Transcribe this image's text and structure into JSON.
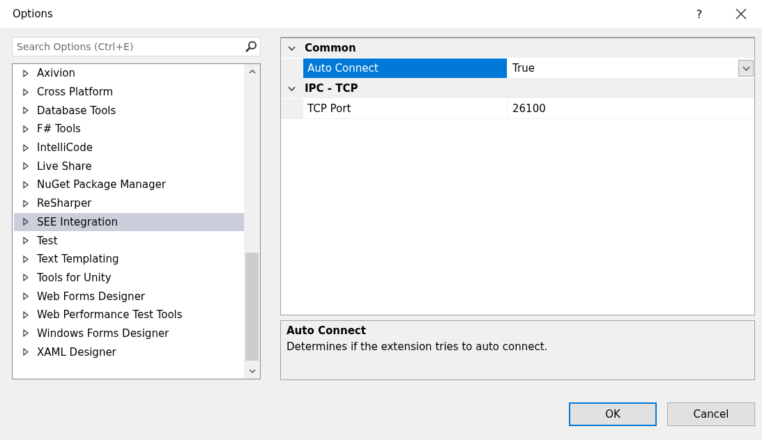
{
  "window": {
    "title": "Options",
    "help": "?"
  },
  "search": {
    "placeholder": "Search Options (Ctrl+E)"
  },
  "tree": {
    "items": [
      {
        "label": "Axivion",
        "selected": false,
        "expanded": false
      },
      {
        "label": "Cross Platform",
        "selected": false,
        "expanded": false
      },
      {
        "label": "Database Tools",
        "selected": false,
        "expanded": false
      },
      {
        "label": "F# Tools",
        "selected": false,
        "expanded": false
      },
      {
        "label": "IntelliCode",
        "selected": false,
        "expanded": false
      },
      {
        "label": "Live Share",
        "selected": false,
        "expanded": false
      },
      {
        "label": "NuGet Package Manager",
        "selected": false,
        "expanded": false
      },
      {
        "label": "ReSharper",
        "selected": false,
        "expanded": false
      },
      {
        "label": "SEE Integration",
        "selected": true,
        "expanded": false
      },
      {
        "label": "Test",
        "selected": false,
        "expanded": false
      },
      {
        "label": "Text Templating",
        "selected": false,
        "expanded": false
      },
      {
        "label": "Tools for Unity",
        "selected": false,
        "expanded": false
      },
      {
        "label": "Web Forms Designer",
        "selected": false,
        "expanded": false
      },
      {
        "label": "Web Performance Test Tools",
        "selected": false,
        "expanded": false
      },
      {
        "label": "Windows Forms Designer",
        "selected": false,
        "expanded": false
      },
      {
        "label": "XAML Designer",
        "selected": false,
        "expanded": false
      }
    ]
  },
  "property_grid": {
    "categories": [
      {
        "name": "Common",
        "expanded": true,
        "properties": [
          {
            "name": "Auto Connect",
            "value": "True",
            "selected": true
          }
        ]
      },
      {
        "name": "IPC - TCP",
        "expanded": true,
        "properties": [
          {
            "name": "TCP Port",
            "value": "26100",
            "selected": false
          }
        ]
      }
    ]
  },
  "description": {
    "title": "Auto Connect",
    "text": "Determines if the extension tries to auto connect."
  },
  "buttons": [
    {
      "label": "OK",
      "default": true
    },
    {
      "label": "Cancel",
      "default": false
    }
  ]
}
